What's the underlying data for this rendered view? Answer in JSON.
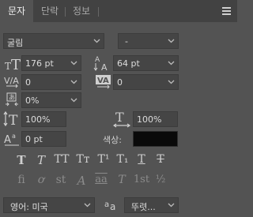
{
  "tabs": [
    {
      "label": "문자",
      "active": true
    },
    {
      "label": "단락",
      "active": false
    },
    {
      "label": "정보",
      "active": false
    }
  ],
  "font": {
    "family": "굴림",
    "style": "-"
  },
  "size": {
    "value": "176 pt"
  },
  "leading": {
    "value": "64 pt"
  },
  "kerning": {
    "value": "0"
  },
  "tracking": {
    "value": "0"
  },
  "tsume": {
    "value": "0%"
  },
  "vscale": {
    "value": "100%"
  },
  "hscale": {
    "value": "100%"
  },
  "baseline": {
    "value": "0 pt"
  },
  "color": {
    "label": "색상:",
    "value": "#0a0a0a"
  },
  "style_buttons": [
    "T",
    "T",
    "TT",
    "Tт",
    "T¹",
    "T₁",
    "T",
    "T"
  ],
  "opentype_buttons": [
    "fi",
    "ơ",
    "st",
    "A",
    "aa",
    "T",
    "1st",
    "½"
  ],
  "language": {
    "value": "영어: 미국"
  },
  "antialias": {
    "icon": "aa",
    "value": "뚜렷..."
  }
}
